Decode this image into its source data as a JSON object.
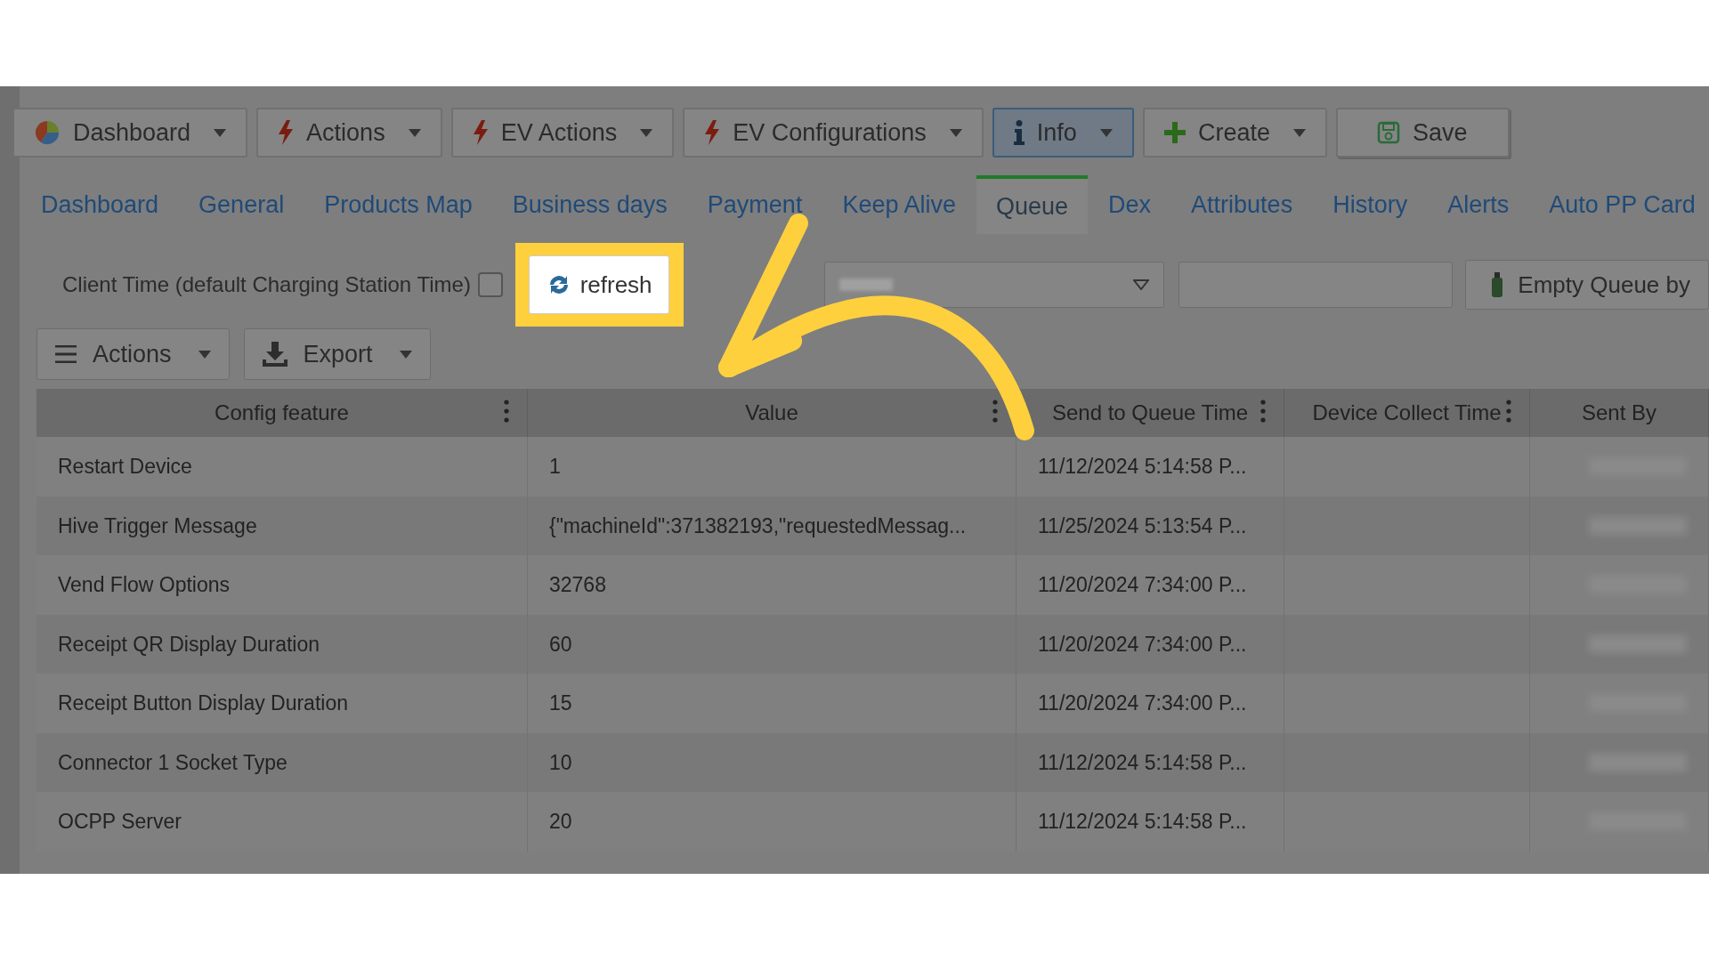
{
  "toolbar": [
    {
      "label": "Dashboard",
      "kind": "pie",
      "dropdown": true,
      "active": false
    },
    {
      "label": "Actions",
      "kind": "bolt",
      "dropdown": true,
      "active": false
    },
    {
      "label": "EV Actions",
      "kind": "bolt",
      "dropdown": true,
      "active": false
    },
    {
      "label": "EV Configurations",
      "kind": "bolt",
      "dropdown": true,
      "active": false
    },
    {
      "label": "Info",
      "kind": "info",
      "dropdown": true,
      "active": true
    },
    {
      "label": "Create",
      "kind": "plus",
      "dropdown": true,
      "active": false
    },
    {
      "label": "Save",
      "kind": "save",
      "dropdown": false,
      "active": false
    }
  ],
  "tabs": [
    {
      "label": "Dashboard",
      "selected": false
    },
    {
      "label": "General",
      "selected": false
    },
    {
      "label": "Products Map",
      "selected": false
    },
    {
      "label": "Business days",
      "selected": false
    },
    {
      "label": "Payment",
      "selected": false
    },
    {
      "label": "Keep Alive",
      "selected": false
    },
    {
      "label": "Queue",
      "selected": true
    },
    {
      "label": "Dex",
      "selected": false
    },
    {
      "label": "Attributes",
      "selected": false
    },
    {
      "label": "History",
      "selected": false
    },
    {
      "label": "Alerts",
      "selected": false
    },
    {
      "label": "Auto PP Card",
      "selected": false
    }
  ],
  "client_time": {
    "label": "Client Time (default Charging Station Time)",
    "checked": false
  },
  "refresh_button": {
    "label": "refresh",
    "highlighted": true
  },
  "empty_queue_button": {
    "label": "Empty Queue by"
  },
  "grid_actions": [
    {
      "label": "Actions",
      "kind": "menu"
    },
    {
      "label": "Export",
      "kind": "download"
    }
  ],
  "table": {
    "columns": [
      "Config feature",
      "Value",
      "Send to Queue Time",
      "Device Collect Time",
      "Sent By"
    ],
    "rows": [
      [
        "Restart Device",
        "1",
        "11/12/2024 5:14:58 P..."
      ],
      [
        "Hive Trigger Message",
        "{\"machineId\":371382193,\"requestedMessag...",
        "11/25/2024 5:13:54 P..."
      ],
      [
        "Vend Flow Options",
        "32768",
        "11/20/2024 7:34:00 P..."
      ],
      [
        "Receipt QR Display Duration",
        "60",
        "11/20/2024 7:34:00 P..."
      ],
      [
        "Receipt Button Display Duration",
        "15",
        "11/20/2024 7:34:00 P..."
      ],
      [
        "Connector 1 Socket Type",
        "10",
        "11/12/2024 5:14:58 P..."
      ],
      [
        "OCPP Server",
        "20",
        "11/12/2024 5:14:58 P..."
      ]
    ]
  }
}
